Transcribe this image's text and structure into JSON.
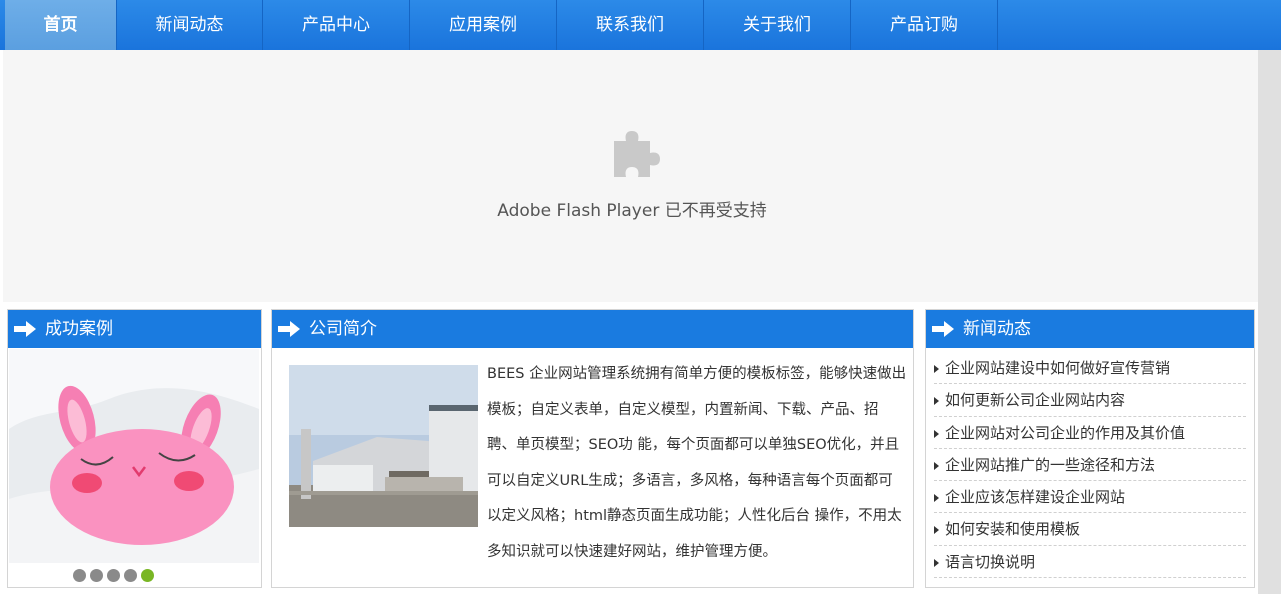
{
  "nav": {
    "items": [
      {
        "label": "首页",
        "active": true
      },
      {
        "label": "新闻动态",
        "active": false
      },
      {
        "label": "产品中心",
        "active": false
      },
      {
        "label": "应用案例",
        "active": false
      },
      {
        "label": "联系我们",
        "active": false
      },
      {
        "label": "关于我们",
        "active": false
      },
      {
        "label": "产品订购",
        "active": false
      }
    ]
  },
  "flash": {
    "icon": "puzzle-piece-icon",
    "message": "Adobe Flash Player 已不再受支持"
  },
  "cases": {
    "title": "成功案例",
    "icon": "arrow-right-icon",
    "slide_count": 5,
    "active_slide": 5
  },
  "about": {
    "title": "公司简介",
    "icon": "arrow-right-icon",
    "text": "BEES 企业网站管理系统拥有简单方便的模板标签，能够快速做出模板；自定义表单，自定义模型，内置新闻、下载、产品、招聘、单页模型；SEO功 能，每个页面都可以单独SEO优化，并且可以自定义URL生成；多语言，多风格，每种语言每个页面都可以定义风格；html静态页面生成功能；人性化后台 操作，不用太多知识就可以快速建好网站，维护管理方便。"
  },
  "news": {
    "title": "新闻动态",
    "icon": "arrow-right-icon",
    "items": [
      "企业网站建设中如何做好宣传营销",
      "如何更新公司企业网站内容",
      "企业网站对公司企业的作用及其价值",
      "企业网站推广的一些途径和方法",
      "企业应该怎样建设企业网站",
      "如何安装和使用模板",
      "语言切换说明"
    ]
  },
  "colors": {
    "nav_blue": "#1a74dc",
    "panel_head": "#1a7be0",
    "dot_active": "#79b624"
  }
}
